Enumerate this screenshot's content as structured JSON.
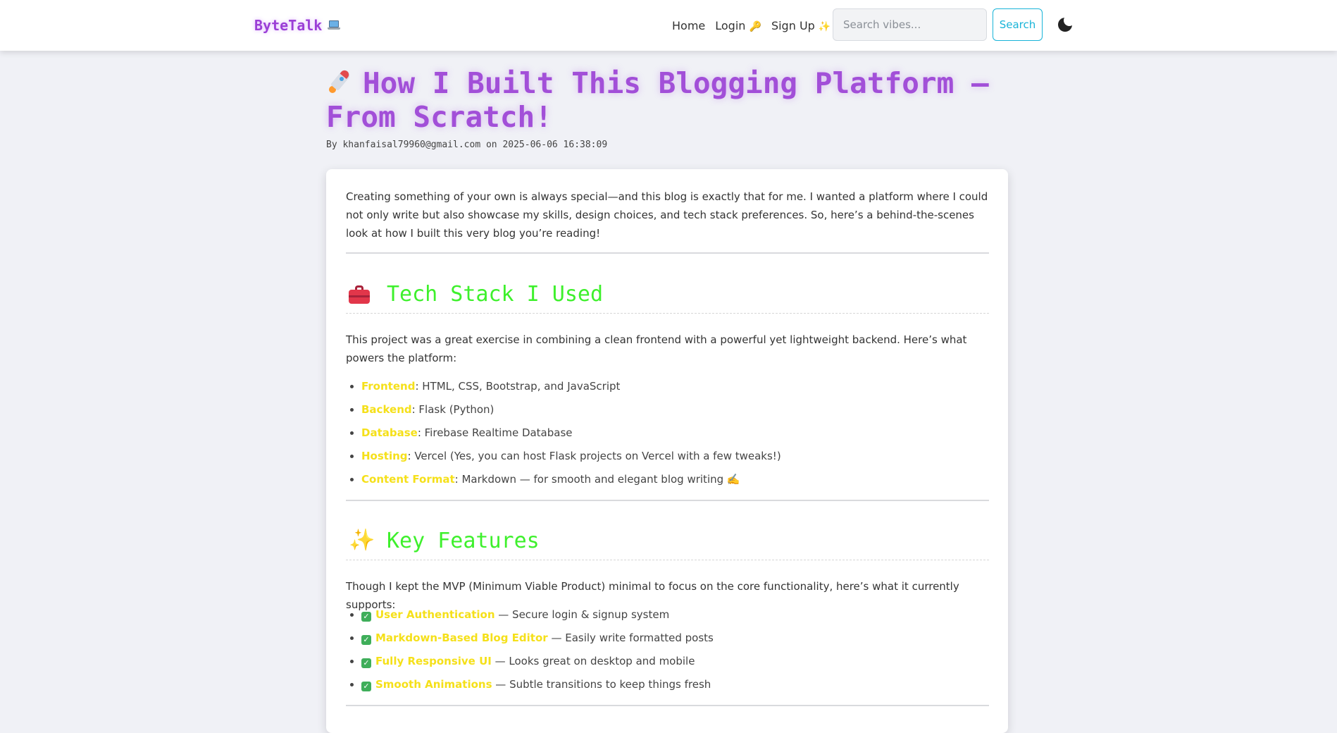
{
  "navbar": {
    "brand": "ByteTalk",
    "brand_icon": "laptop-icon",
    "links": [
      {
        "label": "Home",
        "emoji": ""
      },
      {
        "label": "Login",
        "emoji": "🔑"
      },
      {
        "label": "Sign Up",
        "emoji": "✨"
      }
    ],
    "search_placeholder": "Search vibes...",
    "search_value": "",
    "search_button": "Search",
    "theme_toggle_icon": "moon-icon"
  },
  "post": {
    "title": "How I Built This Blogging Platform — From Scratch!",
    "title_icon": "rocket-icon",
    "byline": "By khanfaisal79960@gmail.com on 2025-06-06 16:38:09",
    "intro": "Creating something of your own is always special—and this blog is exactly that for me. I wanted a platform where I could not only write but also showcase my skills, design choices, and tech stack preferences. So, here’s a behind-the-scenes look at how I built this very blog you’re reading!",
    "sections": [
      {
        "heading": "Tech Stack I Used",
        "icon": "toolbox-icon",
        "text": "This project was a great exercise in combining a clean frontend with a powerful yet lightweight backend. Here’s what powers the platform:",
        "items": [
          {
            "term": "Frontend",
            "desc": ": HTML, CSS, Bootstrap, and JavaScript"
          },
          {
            "term": "Backend",
            "desc": ": Flask (Python)"
          },
          {
            "term": "Database",
            "desc": ": Firebase Realtime Database"
          },
          {
            "term": "Hosting",
            "desc": ": Vercel (Yes, you can host Flask projects on Vercel with a few tweaks!)"
          },
          {
            "term": "Content Format",
            "desc": ": Markdown — for smooth and elegant blog writing ✍️"
          }
        ]
      },
      {
        "heading": "Key Features",
        "icon": "sparkles-icon",
        "text": "Though I kept the MVP (Minimum Viable Product) minimal to focus on the core functionality, here’s what it currently supports:",
        "items": [
          {
            "term": "User Authentication",
            "desc": " — Secure login & signup system"
          },
          {
            "term": "Markdown-Based Blog Editor",
            "desc": " — Easily write formatted posts"
          },
          {
            "term": "Fully Responsive UI",
            "desc": " — Looks great on desktop and mobile"
          },
          {
            "term": "Smooth Animations",
            "desc": " — Subtle transitions to keep things fresh"
          }
        ]
      }
    ]
  },
  "colors": {
    "brand": "#9b3fd6",
    "title": "#a24fd8",
    "section_heading": "#3ef02c",
    "highlight": "#f5e01a",
    "search_button": "#18b4d8",
    "page_background": "#f0f1f6"
  }
}
